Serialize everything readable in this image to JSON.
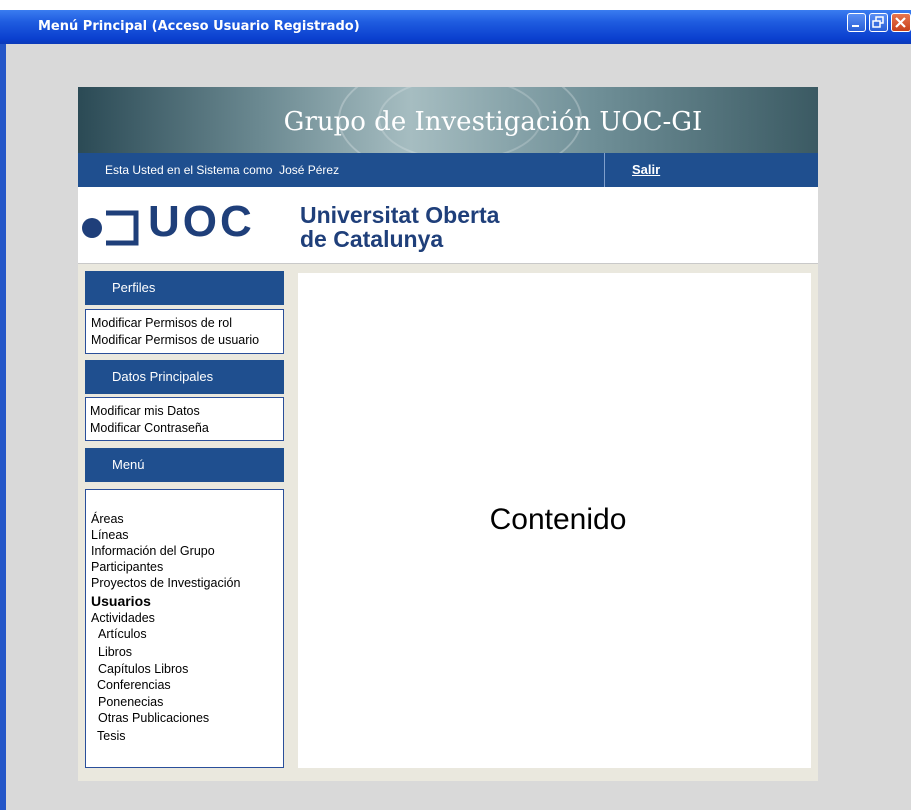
{
  "window": {
    "title": "Menú Principal (Acceso Usuario Registrado)",
    "buttons": [
      {
        "icon": "minimize-icon"
      },
      {
        "icon": "restore-icon"
      },
      {
        "icon": "close-icon"
      }
    ]
  },
  "header": {
    "banner_title": "Grupo de Investigación UOC-GI",
    "session_text": "Esta Usted en el Sistema como  José Pérez",
    "logout_label": "Salir",
    "logo_abbr": "UOC",
    "university_line1": "Universitat Oberta",
    "university_line2": "de Catalunya"
  },
  "sidebar": {
    "perfiles": {
      "title": "Perfiles",
      "items": [
        "Modificar Permisos de rol",
        "Modificar Permisos de usuario"
      ]
    },
    "datos": {
      "title": "Datos Principales",
      "items": [
        "Modificar mis Datos",
        "Modificar Contraseña"
      ]
    },
    "menu": {
      "title": "Menú",
      "items": [
        "Áreas",
        "Líneas",
        "Información del Grupo",
        "Participantes",
        "Proyectos de Investigación",
        "Usuarios",
        "Actividades",
        "Artículos",
        "Libros",
        "Capítulos Libros",
        "Conferencias",
        "Ponenecias",
        "Otras Publicaciones",
        "Tesis"
      ],
      "active_item": "Usuarios"
    }
  },
  "main": {
    "content_label": "Contenido"
  },
  "colors": {
    "titlebar": "#0a3fcf",
    "nav_blue": "#1f4f8f",
    "page_bg": "#eae8de",
    "desktop_bg": "#d9d9d9"
  }
}
